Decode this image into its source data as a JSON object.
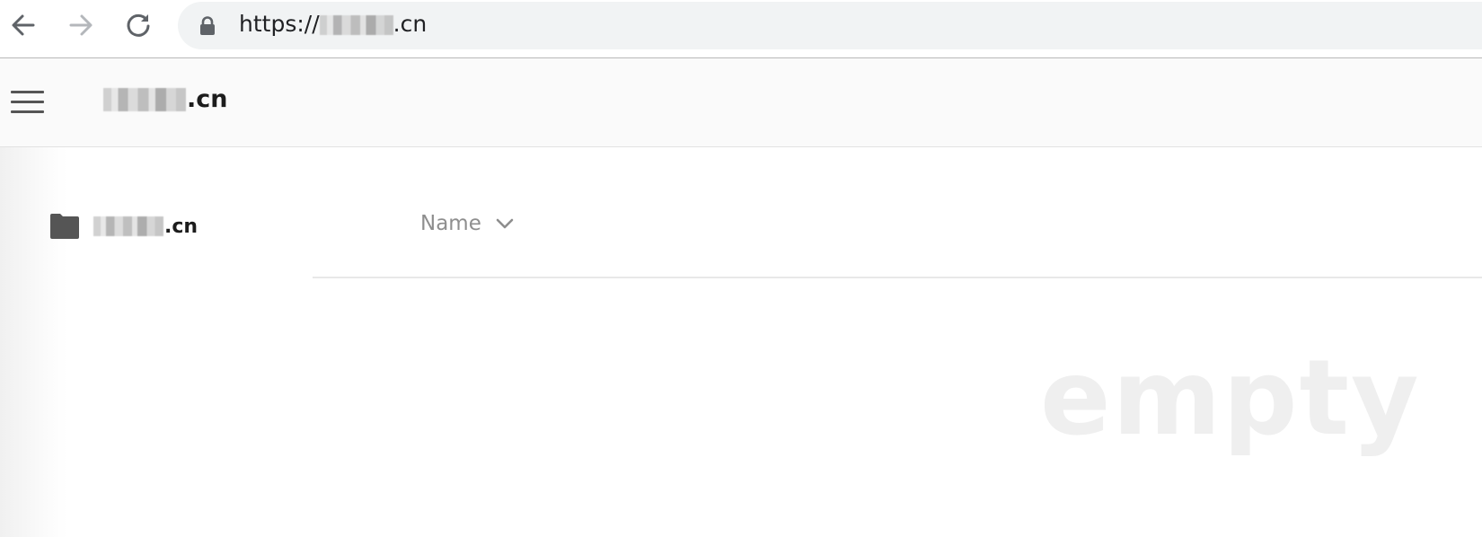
{
  "browser": {
    "url_prefix": "https://",
    "url_suffix": ".cn"
  },
  "header": {
    "title_suffix": ".cn"
  },
  "sidebar": {
    "folder_suffix": ".cn"
  },
  "file_list": {
    "sort_label": "Name",
    "empty_text": "empty"
  },
  "icons": {
    "back": "back-arrow-icon",
    "forward": "forward-arrow-icon",
    "reload": "reload-icon",
    "lock": "lock-icon",
    "menu": "hamburger-menu-icon",
    "folder": "folder-icon",
    "sort": "chevron-down-icon"
  },
  "colors": {
    "header_bg": "#fafafa",
    "address_bar_bg": "#f1f3f4",
    "text_dark": "#1c1c1c",
    "text_muted": "#8e8e8e",
    "watermark": "#efefef",
    "folder": "#555555"
  }
}
